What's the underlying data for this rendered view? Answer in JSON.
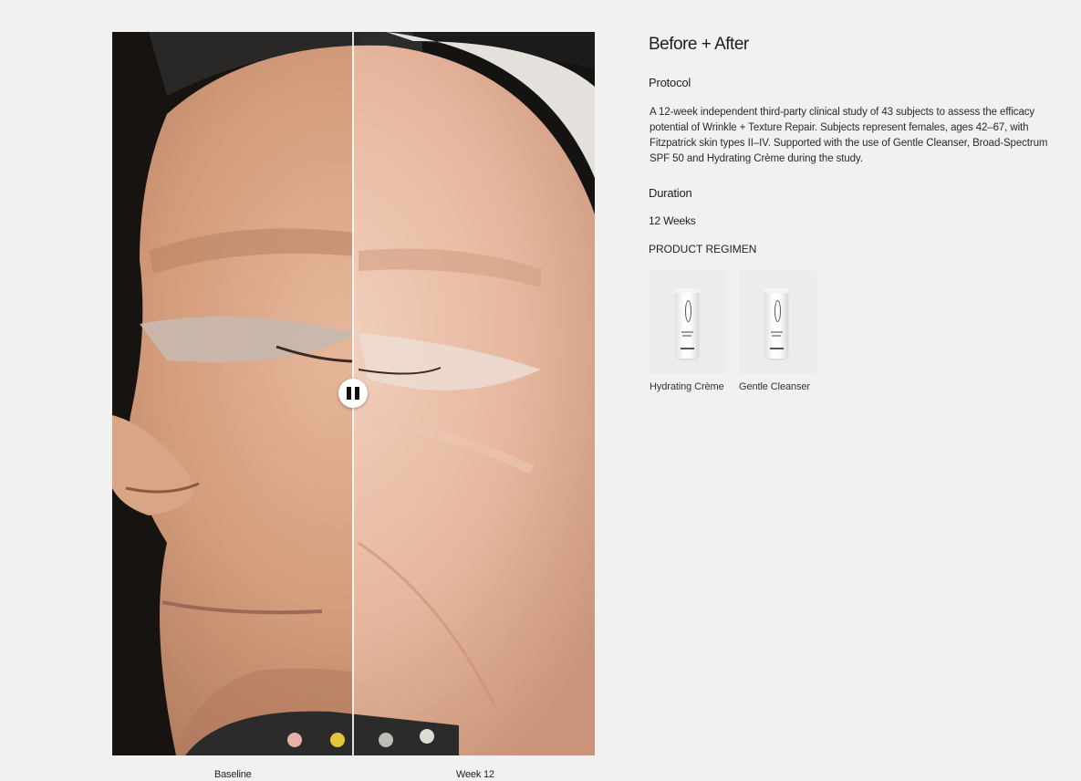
{
  "comparison": {
    "before_label": "Baseline",
    "after_label": "Week 12",
    "slider_position": 0.5
  },
  "info": {
    "title": "Before + After",
    "protocol_label": "Protocol",
    "protocol_text": "A 12-week independent third-party clinical study of 43 subjects to assess the efficacy potential of Wrinkle + Texture Repair. Subjects represent females, ages 42–67, with Fitzpatrick skin types II–IV. Supported with the use of Gentle Cleanser, Broad-Spectrum SPF 50 and Hydrating Crème during the study.",
    "duration_label": "Duration",
    "duration_value": "12 Weeks",
    "regimen_label": "PRODUCT REGIMEN",
    "products": [
      {
        "name": "Hydrating Crème",
        "icon": "product-tube-icon"
      },
      {
        "name": "Gentle Cleanser",
        "icon": "product-tube-icon"
      }
    ]
  },
  "colors": {
    "page_background": "#f1f1f1",
    "text": "#222222",
    "handle": "#ffffff"
  }
}
